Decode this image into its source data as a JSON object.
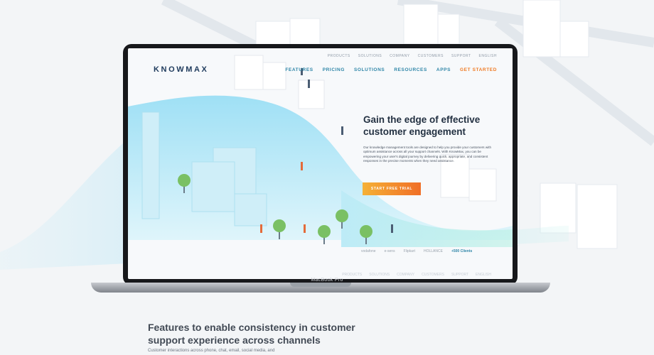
{
  "brand": "KNOWMAX",
  "top_nav": [
    "PRODUCTS",
    "SOLUTIONS",
    "COMPANY",
    "CUSTOMERS",
    "SUPPORT",
    "ENGLISH"
  ],
  "main_nav": [
    "FEATURES",
    "PRICING",
    "SOLUTIONS",
    "RESOURCES",
    "APPS"
  ],
  "main_nav_cta": "GET STARTED",
  "hero": {
    "title_line1": "Gain the edge of effective",
    "title_line2": "customer engagement",
    "body": "Our knowledge management tools are designed to help you provide your customers with optimum assistance across all your support channels. With KnowMax, you can be empowering your user's digital journey by delivering quick, appropriate, and consistent responses in the precise moments when they need assistance.",
    "cta": "START FREE TRIAL"
  },
  "client_logos": [
    "vodafone",
    "e-sens",
    "Flipkart",
    "HOLLANCE"
  ],
  "clients_link": "+500 Clients",
  "device_label": "MacBook Pro",
  "section": {
    "title_line1": "Features to enable consistency in customer",
    "title_line2": "support experience across channels",
    "body": "Customer interactions across phone, chat, email, social media, and"
  },
  "colors": {
    "brand": "#1e3a5c",
    "nav_link": "#2f86a8",
    "cta_orange": "#f07b24",
    "wave": "#7fd3ef"
  }
}
